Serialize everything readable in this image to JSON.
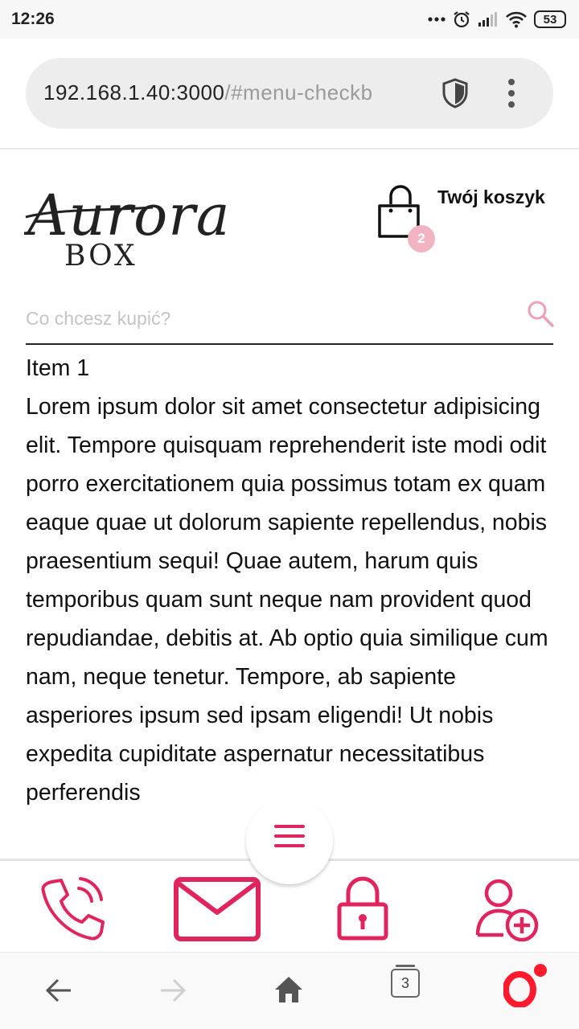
{
  "status_bar": {
    "time": "12:26",
    "battery": "53"
  },
  "browser": {
    "url_host": "192.168.1.40:3000",
    "url_path": "/#menu-checkb"
  },
  "header": {
    "logo_script": "Aurora",
    "logo_sub": "BOX",
    "cart_label": "Twój koszyk",
    "cart_count": "2"
  },
  "search": {
    "placeholder": "Co chcesz kupić?"
  },
  "content": {
    "item_title": "Item 1",
    "item_body": "Lorem ipsum dolor sit amet consectetur adipisicing elit. Tempore quisquam reprehenderit iste modi odit porro exercitationem quia possimus totam ex quam eaque quae ut dolorum sapiente repellendus, nobis praesentium sequi! Quae autem, harum quis temporibus quam sunt neque nam provident quod repudiandae, debitis at. Ab optio quia similique cum nam, neque tenetur. Tempore, ab sapiente asperiores ipsum sed ipsam eligendi! Ut nobis expedita cupiditate aspernatur necessitatibus perferendis"
  },
  "browser_nav": {
    "tabs_count": "3"
  },
  "colors": {
    "accent": "#e0245e",
    "badge": "#f2b3c2"
  },
  "icons": [
    "phone-icon",
    "mail-icon",
    "lock-icon",
    "add-user-icon",
    "menu-icon",
    "cart-icon",
    "search-icon",
    "shield-icon"
  ]
}
